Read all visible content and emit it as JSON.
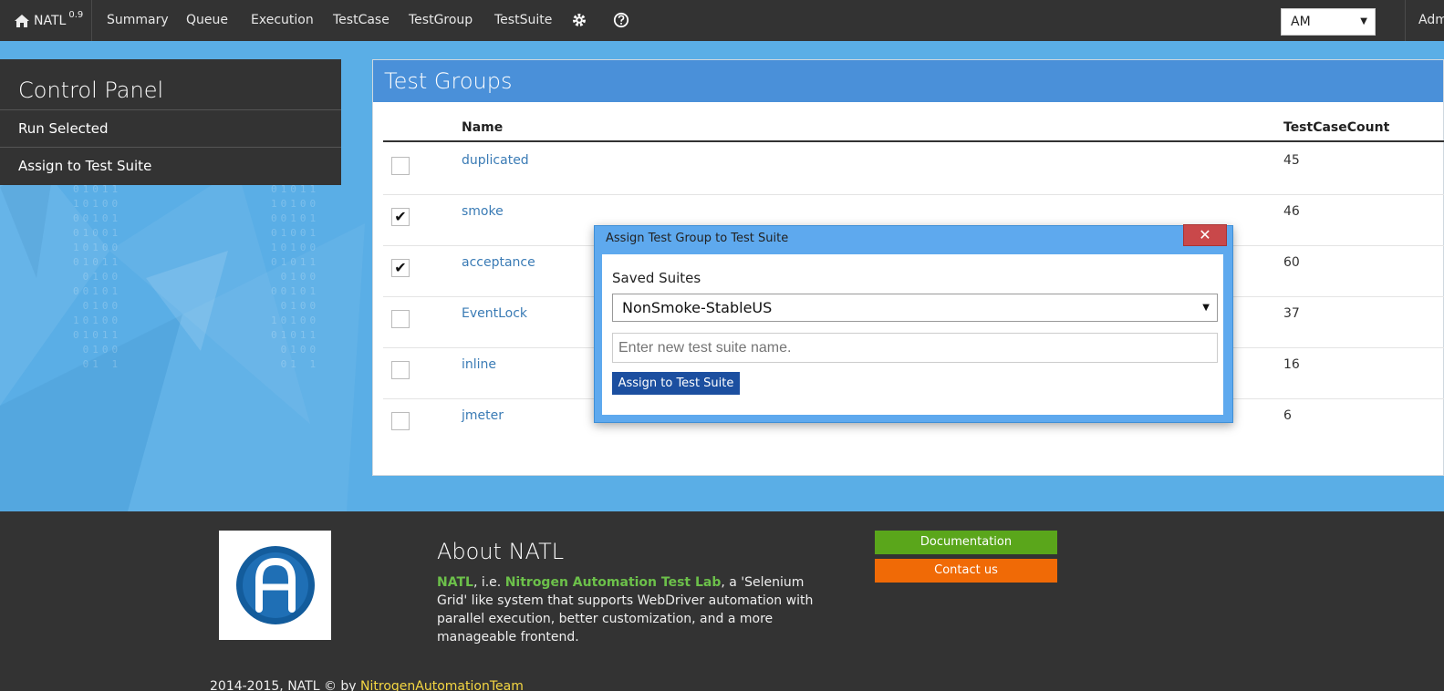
{
  "nav": {
    "brand": "NATL",
    "version": "0.9",
    "items": [
      "Summary",
      "Queue",
      "Execution",
      "TestCase",
      "TestGroup",
      "TestSuite"
    ],
    "settings_icon": "gear-icon",
    "help_icon": "help-icon",
    "role_value": "AM",
    "user": "Admin"
  },
  "control_panel": {
    "title": "Control Panel",
    "items": [
      "Run Selected",
      "Assign to Test Suite"
    ]
  },
  "groups": {
    "title": "Test Groups",
    "columns": [
      "Name",
      "TestCaseCount"
    ],
    "rows": [
      {
        "name": "duplicated",
        "count": "45",
        "checked": false
      },
      {
        "name": "smoke",
        "count": "46",
        "checked": true
      },
      {
        "name": "acceptance",
        "count": "60",
        "checked": true
      },
      {
        "name": "EventLock",
        "count": "37",
        "checked": false
      },
      {
        "name": "inline",
        "count": "16",
        "checked": false
      },
      {
        "name": "jmeter",
        "count": "6",
        "checked": false
      }
    ]
  },
  "modal": {
    "title": "Assign Test Group to Test Suite",
    "close_symbol": "✕",
    "saved_label": "Saved Suites",
    "selected_suite": "NonSmoke-StableUS",
    "new_suite_placeholder": "Enter new test suite name.",
    "assign_button": "Assign to Test Suite"
  },
  "footer": {
    "about_title": "About NATL",
    "about_hl1": "NATL",
    "about_mid1": ", i.e. ",
    "about_hl2": "Nitrogen Automation Test Lab",
    "about_rest": ", a 'Selenium Grid' like system that supports WebDriver automation with parallel execution, better customization, and a more manageable frontend.",
    "doc_button": "Documentation",
    "contact_button": "Contact us",
    "copyright_prefix": "2014-2015, NATL © by ",
    "copyright_team": "NitrogenAutomationTeam"
  },
  "colors": {
    "nav_bg": "#333333",
    "header_blue": "#4a90d9",
    "modal_blue": "#5ea9ee",
    "close_red": "#c9484a",
    "doc_green": "#5aa61b",
    "contact_orange": "#f06a06",
    "link_blue": "#3a7bb5"
  }
}
